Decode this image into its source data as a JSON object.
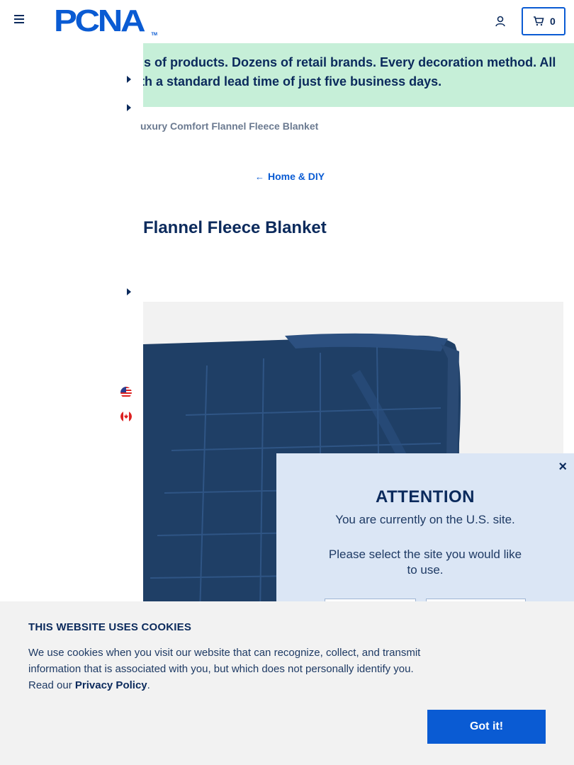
{
  "header": {
    "logo_text": "PCNA",
    "logo_tm": "TM",
    "cart_count": "0"
  },
  "banner": {
    "line1": "ls of products. Dozens of retail brands. Every decoration method. All",
    "line2": "th a standard lead time of just five business days."
  },
  "breadcrumb": "uxury Comfort Flannel Fleece Blanket",
  "back_link": "Home & DIY",
  "product_title": "Flannel Fleece Blanket",
  "modal": {
    "close": "×",
    "title": "ATTENTION",
    "line1": "You are currently on the U.S. site.",
    "line2": "Please select the site you would like to use."
  },
  "cookie": {
    "title": "THIS WEBSITE USES COOKIES",
    "text": "We use cookies when you visit our website that can recognize, collect, and transmit information that is associated with you, but which does not personally identify you. Read our",
    "link": "Privacy Policy",
    "period": ".",
    "button": "Got it!"
  },
  "colors": {
    "brand_blue": "#0a5bd3",
    "navy": "#0b2a5c",
    "banner_green": "#c6efd8",
    "modal_bg": "#dbe6f5",
    "blanket": "#1f3f66"
  },
  "icons": [
    "hamburger-menu-icon",
    "user-icon",
    "cart-icon",
    "caret-right-icon",
    "arrow-left-icon",
    "us-flag-icon",
    "canada-flag-icon",
    "close-icon"
  ]
}
